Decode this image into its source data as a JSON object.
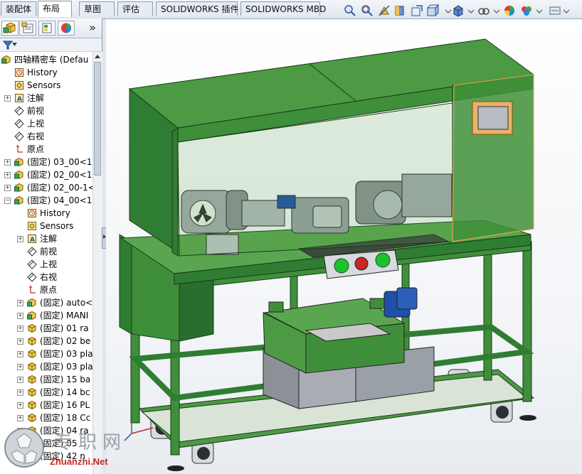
{
  "tabs": [
    {
      "label": "装配体",
      "active": false
    },
    {
      "label": "布局",
      "active": true
    },
    {
      "label": "草图",
      "active": false
    },
    {
      "label": "评估",
      "active": false
    },
    {
      "label": "SOLIDWORKS 插件",
      "active": false
    },
    {
      "label": "SOLIDWORKS MBD",
      "active": false
    }
  ],
  "panel": {
    "collapse_glyph": "»",
    "filter_icon": "funnel-icon"
  },
  "tree": {
    "root": "四轴精密车 (Defau",
    "items": [
      {
        "label": "History",
        "icon": "history-icon"
      },
      {
        "label": "Sensors",
        "icon": "sensors-icon"
      },
      {
        "label": "注解",
        "icon": "annotation-icon"
      },
      {
        "label": "前视",
        "icon": "plane-icon"
      },
      {
        "label": "上视",
        "icon": "plane-icon"
      },
      {
        "label": "右视",
        "icon": "plane-icon"
      },
      {
        "label": "原点",
        "icon": "origin-icon"
      },
      {
        "label": "(固定) 03_00<1",
        "icon": "assembly-icon"
      },
      {
        "label": "(固定) 02_00<1",
        "icon": "assembly-icon"
      },
      {
        "label": "(固定) 02_00-1<",
        "icon": "assembly-icon"
      },
      {
        "label": "(固定) 04_00<1",
        "icon": "assembly-icon"
      },
      {
        "label": "History",
        "icon": "history-icon"
      },
      {
        "label": "Sensors",
        "icon": "sensors-icon"
      },
      {
        "label": "注解",
        "icon": "annotation-icon"
      },
      {
        "label": "前视",
        "icon": "plane-icon"
      },
      {
        "label": "上视",
        "icon": "plane-icon"
      },
      {
        "label": "右视",
        "icon": "plane-icon"
      },
      {
        "label": "原点",
        "icon": "origin-icon"
      },
      {
        "label": "(固定) auto<",
        "icon": "assembly-icon"
      },
      {
        "label": "(固定) MANI",
        "icon": "assembly-icon"
      },
      {
        "label": "(固定) 01 ra",
        "icon": "part-icon"
      },
      {
        "label": "(固定) 02 be",
        "icon": "part-icon"
      },
      {
        "label": "(固定) 03 pla",
        "icon": "part-icon"
      },
      {
        "label": "(固定) 03 pla",
        "icon": "part-icon"
      },
      {
        "label": "(固定) 15 ba",
        "icon": "part-icon"
      },
      {
        "label": "(固定) 14 bc",
        "icon": "part-icon"
      },
      {
        "label": "(固定) 16 PL",
        "icon": "part-icon"
      },
      {
        "label": "(固定) 18 Cc",
        "icon": "part-icon"
      },
      {
        "label": "(固定) 04 ra",
        "icon": "part-icon"
      },
      {
        "label": "(固定) 05",
        "icon": "part-icon"
      },
      {
        "label": "(固定) 42 n",
        "icon": "part-icon"
      }
    ]
  },
  "watermark": {
    "title": "专职网",
    "url": "Zhuanzhi.Net"
  },
  "colors": {
    "machine_green": "#2f7d32",
    "frame_green": "#3f8f3a",
    "accent_blue": "#1f4fa8"
  }
}
